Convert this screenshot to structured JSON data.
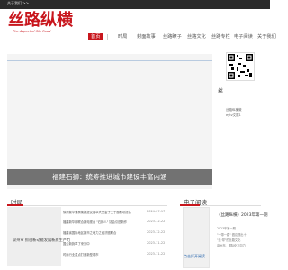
{
  "topbar": {
    "about": "关于我们 >>"
  },
  "header": {
    "logo": "丝路纵横",
    "logo_en": "The Aspect of Silk Road"
  },
  "nav": {
    "items": [
      "首页",
      "时局",
      "封面故事",
      "丝路瞭子",
      "丝路文化",
      "丝路专栏",
      "电子阅读",
      "关于我们"
    ],
    "active": "首页"
  },
  "sidebar": {
    "qr_label": "丝",
    "qr_small": "丝路纵横微",
    "qr_note": "eytv文展1"
  },
  "banner": {
    "caption": "福建石狮：统筹推进城市建设丰富内涵"
  },
  "sections": {
    "news_title": "时局",
    "ereader_title": "电子阅读"
  },
  "news": {
    "items": [
      {
        "title": "徐州繁华蒲葵集报提议奏章大全金子王子题教项提名",
        "date": "2024-07-17"
      },
      {
        "title": "福建新华网联合报电视台 \"石狮人\" 协会引进新作",
        "date": "2023-12-22"
      },
      {
        "title": "福建省国际地区报市之地力之经济圈联合",
        "date": "2023-12-22"
      },
      {
        "title": "国企新篇章了来到中",
        "date": "2023-11-22"
      },
      {
        "title": "时尚行业重点打造新型城市",
        "date": "2023-11-22"
      }
    ],
    "image_caption": "泉州市 抓创新动能发展新质生产力"
  },
  "ereader": {
    "title": "《丝路纵横》2023年第一期",
    "text1": "《丝路纵横》",
    "text2": "2023年第一期",
    "text3": "\"一带一路\" 倡议提出十",
    "text4": "\"丝·帮\"的丝路文化",
    "text5": "泉州市、国际化方向力",
    "link": "点击打开阅读"
  }
}
